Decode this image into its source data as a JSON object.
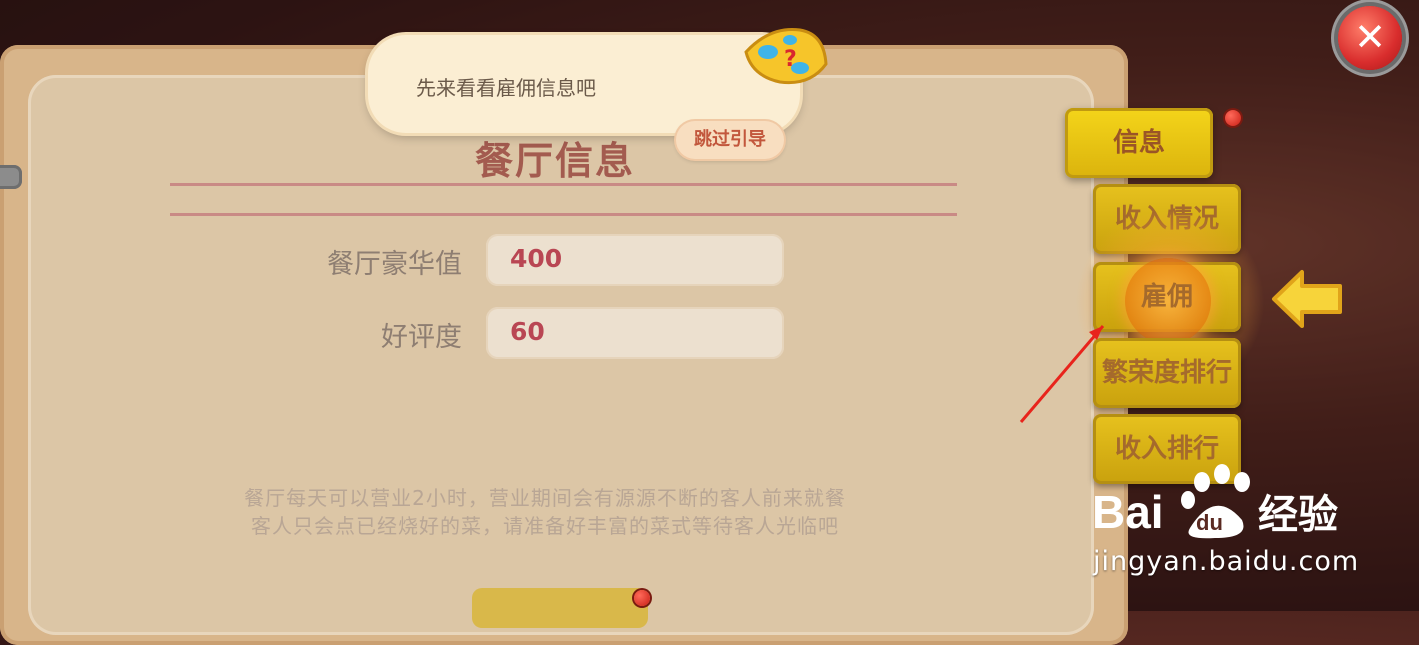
{
  "dialog": {
    "title": "餐厅信息",
    "fields": [
      {
        "label": "餐厅豪华值",
        "value": "400"
      },
      {
        "label": "好评度",
        "value": "60"
      }
    ],
    "description": [
      "餐厅每天可以营业2小时，营业期间会有源源不断的客人前来就餐",
      "客人只会点已经烧好的菜，请准备好丰富的菜式等待客人光临吧"
    ]
  },
  "guide": {
    "message": "先来看看雇佣信息吧",
    "skip_label": "跳过引导"
  },
  "close_icon": "close-icon",
  "tabs": [
    {
      "label": "信息",
      "active": true,
      "badge": true
    },
    {
      "label": "收入情况",
      "active": false,
      "badge": false
    },
    {
      "label": "雇佣",
      "active": false,
      "highlight": true,
      "badge": false
    },
    {
      "label": "繁荣度排行",
      "active": false,
      "badge": false
    },
    {
      "label": "收入排行",
      "active": false,
      "badge": false
    }
  ],
  "watermark": {
    "brand": "Bai du 经验",
    "url": "jingyan.baidu.com"
  },
  "colors": {
    "tab_gold": "#e7c21e",
    "value_red": "#b94653",
    "badge_red": "#c81e14"
  }
}
